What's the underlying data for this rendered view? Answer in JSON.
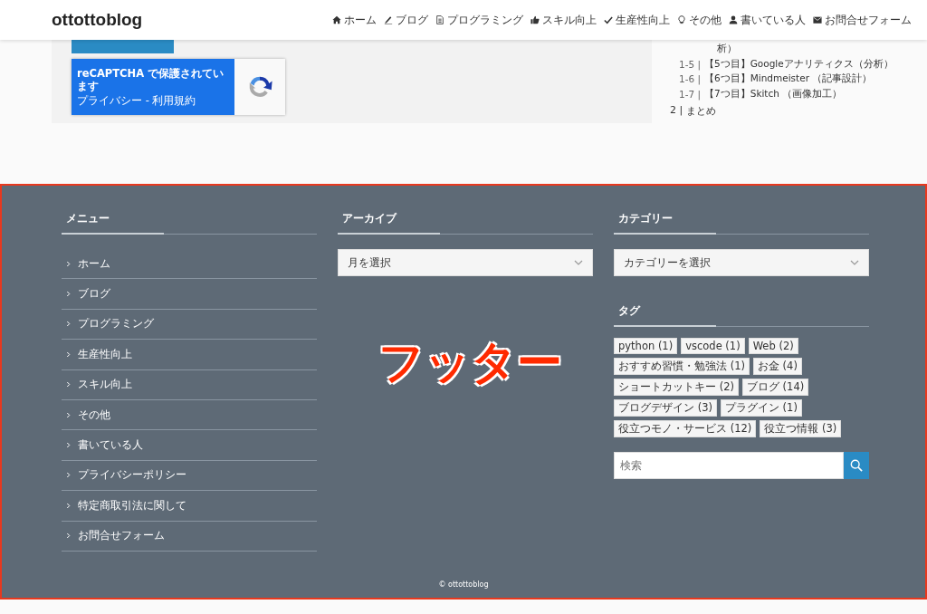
{
  "header": {
    "logo": "ottottoblog",
    "nav": [
      {
        "label": "ホーム",
        "kind": "home"
      },
      {
        "label": "ブログ",
        "kind": "pencil"
      },
      {
        "label": "プログラミング",
        "kind": "document"
      },
      {
        "label": "スキル向上",
        "kind": "thumb"
      },
      {
        "label": "生産性向上",
        "kind": "check"
      },
      {
        "label": "その他",
        "kind": "bulb"
      },
      {
        "label": "書いている人",
        "kind": "person"
      },
      {
        "label": "お問合せフォーム",
        "kind": "mail"
      }
    ]
  },
  "recaptcha": {
    "title": "reCAPTCHA で保護されています",
    "links": "プライバシー - 利用規約"
  },
  "toc": {
    "items": [
      {
        "text": "析）"
      },
      {
        "number": "1-5 |",
        "text": "【5つ目】Googleアナリティクス（分析）"
      },
      {
        "number": "1-6 |",
        "text": "【6つ目】Mindmeister （記事設計）"
      },
      {
        "number": "1-7 |",
        "text": "【7つ目】Skitch （画像加工）"
      }
    ],
    "section": {
      "number": "2 |",
      "text": "まとめ"
    }
  },
  "footer": {
    "menu": {
      "title": "メニュー",
      "items": [
        "ホーム",
        "ブログ",
        "プログラミング",
        "生産性向上",
        "スキル向上",
        "その他",
        "書いている人",
        "プライバシーポリシー",
        "特定商取引法に関して",
        "お問合せフォーム"
      ]
    },
    "archive": {
      "title": "アーカイブ",
      "select": "月を選択"
    },
    "category": {
      "title": "カテゴリー",
      "select": "カテゴリーを選択"
    },
    "tags": {
      "title": "タグ",
      "items": [
        "python (1)",
        "vscode (1)",
        "Web (2)",
        "おすすめ習慣・勉強法 (1)",
        "お金 (4)",
        "ショートカットキー (2)",
        "ブログ (14)",
        "ブログデザイン (3)",
        "プラグイン (1)",
        "役立つモノ・サービス (12)",
        "役立つ情報 (3)"
      ]
    },
    "search": {
      "placeholder": "検索"
    },
    "copyright": "© ottottoblog"
  },
  "annotation": "フッター"
}
